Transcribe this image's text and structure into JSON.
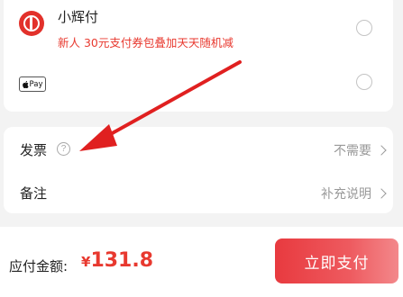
{
  "payment_methods": [
    {
      "name": "小辉付",
      "promo": "新人 30元支付券包叠加天天随机减",
      "icon": "xiaohuifu-logo-icon",
      "brand_color": "#e2312b",
      "selected": false
    },
    {
      "name": "Pay",
      "icon": "apple-pay-icon",
      "selected": false
    }
  ],
  "invoice": {
    "label": "发票",
    "help_icon": "?",
    "value": "不需要"
  },
  "remark": {
    "label": "备注",
    "value": "补充说明"
  },
  "footer": {
    "amount_label": "应付金额:",
    "currency": "¥",
    "amount": "131.8",
    "pay_button": "立即支付"
  },
  "colors": {
    "accent": "#e8392f",
    "arrow": "#e02020",
    "background": "#f3f3f3"
  }
}
